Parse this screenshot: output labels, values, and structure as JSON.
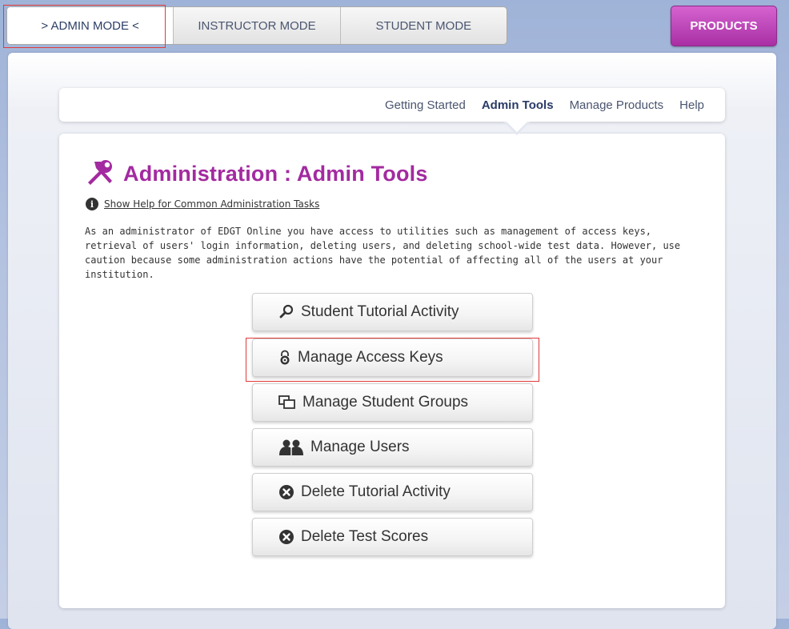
{
  "modes": {
    "admin": "> ADMIN MODE <",
    "instructor": "INSTRUCTOR MODE",
    "student": "STUDENT MODE"
  },
  "products_label": "PRODUCTS",
  "subnav": {
    "getting_started": "Getting Started",
    "admin_tools": "Admin Tools",
    "manage_products": "Manage Products",
    "help": "Help"
  },
  "page": {
    "title": "Administration : Admin Tools",
    "help_link": "Show Help for Common Administration Tasks",
    "description": "As an administrator of EDGT Online you have access to utilities such as management of access keys, retrieval of users' login information, deleting users, and deleting school-wide test data. However, use caution because some administration actions have the potential of affecting all of the users at your institution."
  },
  "tools": {
    "tutorial_activity": "Student Tutorial Activity",
    "access_keys": "Manage Access Keys",
    "student_groups": "Manage Student Groups",
    "users": "Manage Users",
    "delete_tutorial": "Delete Tutorial Activity",
    "delete_scores": "Delete Test Scores"
  },
  "colors": {
    "brand_purple": "#a32aa0",
    "nav_text": "#4a5570"
  }
}
